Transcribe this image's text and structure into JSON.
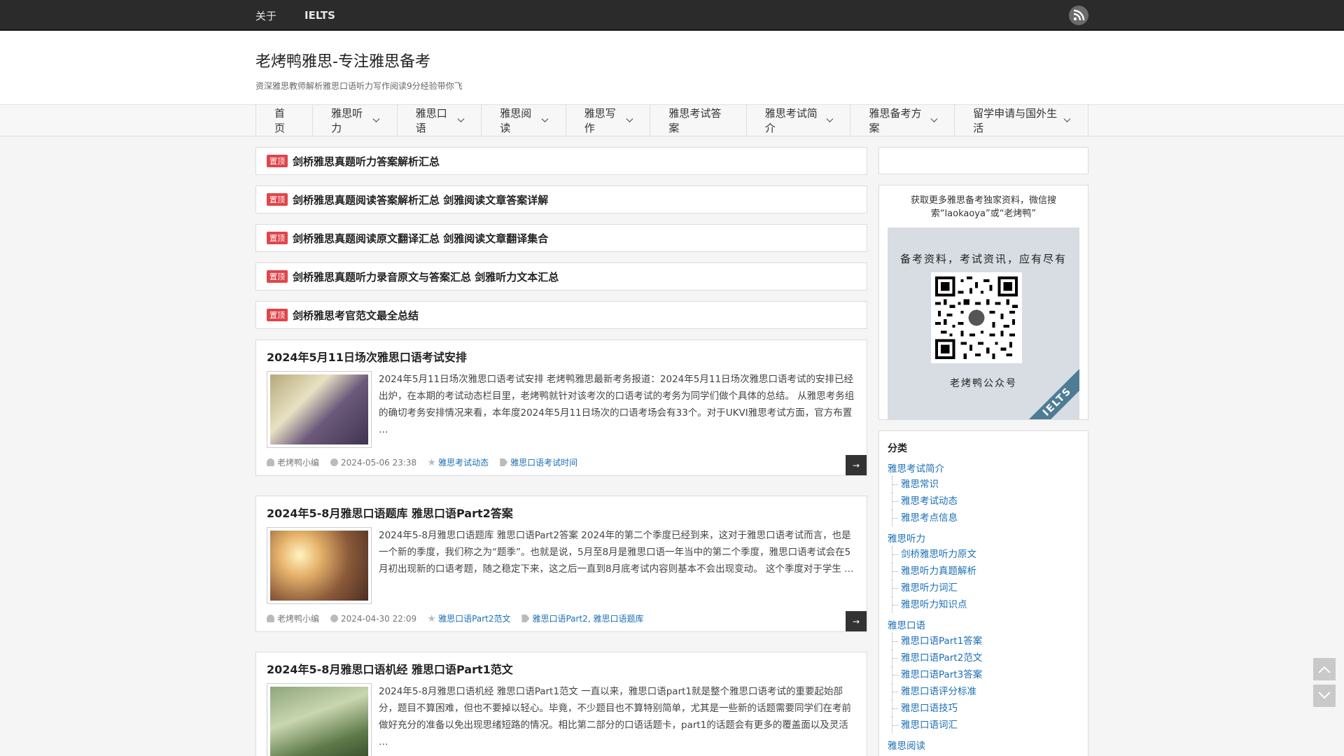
{
  "topbar": {
    "links": [
      "关于",
      "IELTS"
    ]
  },
  "header": {
    "title": "老烤鸭雅思-专注雅思备考",
    "description": "资深雅思教师解析雅思口语听力写作阅读9分经验带你飞"
  },
  "nav": {
    "items": [
      {
        "label": "首页"
      },
      {
        "label": "雅思听力"
      },
      {
        "label": "雅思口语"
      },
      {
        "label": "雅思阅读"
      },
      {
        "label": "雅思写作"
      },
      {
        "label": "雅思考试答案"
      },
      {
        "label": "雅思考试简介"
      },
      {
        "label": "雅思备考方案"
      },
      {
        "label": "留学申请与国外生活"
      }
    ]
  },
  "sticky": {
    "badge": "置顶",
    "items": [
      "剑桥雅思真题听力答案解析汇总",
      "剑桥雅思真题阅读答案解析汇总 剑雅阅读文章答案详解",
      "剑桥雅思真题阅读原文翻译汇总 剑雅阅读文章翻译集合",
      "剑桥雅思真题听力录音原文与答案汇总 剑雅听力文本汇总",
      "剑桥雅思考官范文最全总结"
    ]
  },
  "posts": [
    {
      "title": "2024年5月11日场次雅思口语考试安排",
      "excerpt": "2024年5月11日场次雅思口语考试安排 老烤鸭雅思最新考务报道：2024年5月11日场次雅思口语考试的安排已经出炉，在本期的考试动态栏目里，老烤鸭就针对该考次的口语考试的考务为同学们做个具体的总结。 从雅思考务组的确切考务安排情况来看，本年度2024年5月11日场次的口语考场会有33个。对于UKVI雅思考试方面，官方布置 …",
      "author": "老烤鸭小编",
      "date": "2024-05-06 23:38",
      "category": "雅思考试动态",
      "tags": "雅思口语考试时间"
    },
    {
      "title": "2024年5-8月雅思口语题库 雅思口语Part2答案",
      "excerpt": "2024年5-8月雅思口语题库 雅思口语Part2答案 2024年的第二个季度已经到来，这对于雅思口语考试而言，也是一个新的季度，我们称之为“题季”。也就是说，5月至8月是雅思口语一年当中的第二个季度，雅思口语考试会在5月初出现新的口语考题，随之稳定下来，这之后一直到8月底考试内容则基本不会出现变动。 这个季度对于学生 …",
      "author": "老烤鸭小编",
      "date": "2024-04-30 22:09",
      "category": "雅思口语Part2范文",
      "tags": "雅思口语Part2, 雅思口语题库"
    },
    {
      "title": "2024年5-8月雅思口语机经 雅思口语Part1范文",
      "excerpt": "2024年5-8月雅思口语机经 雅思口语Part1范文 一直以来，雅思口语part1就是整个雅思口语考试的重要起始部分，题目不算困难，但也不要掉以轻心。毕竟，不少题目也不算特别简单，尤其是一些新的话题需要同学们在考前做好充分的准备以免出现思绪短路的情况。相比第二部分的口语话题卡，part1的话题会有更多的覆盖面以及灵活 …"
    }
  ],
  "more_label": "→",
  "sidebar": {
    "qr_text": "获取更多雅思备考独家资料，微信搜索“laokaoya”或“老烤鸭”",
    "qr_slogan": "备考资料，考试资讯，应有尽有",
    "qr_account": "老烤鸭公众号",
    "qr_corner": "IELTS",
    "cat_title": "分类",
    "categories": [
      {
        "name": "雅思考试简介",
        "children": [
          "雅思常识",
          "雅思考试动态",
          "雅思考点信息"
        ]
      },
      {
        "name": "雅思听力",
        "children": [
          "剑桥雅思听力原文",
          "雅思听力真题解析",
          "雅思听力词汇",
          "雅思听力知识点"
        ]
      },
      {
        "name": "雅思口语",
        "children": [
          "雅思口语Part1答案",
          "雅思口语Part2范文",
          "雅思口语Part3答案",
          "雅思口语评分标准",
          "雅思口语技巧",
          "雅思口语词汇"
        ]
      },
      {
        "name": "雅思阅读",
        "children": []
      }
    ]
  },
  "colors": {
    "topbar": "#2b2b2b",
    "link": "#1b6fb5",
    "badge": "#e0454b",
    "accent": "#4e7c95"
  },
  "icons": [
    "rss-icon",
    "chevron-down-icon",
    "user-icon",
    "clock-icon",
    "star-icon",
    "tag-icon",
    "arrow-right-icon",
    "arrow-up-icon",
    "arrow-down-icon"
  ]
}
